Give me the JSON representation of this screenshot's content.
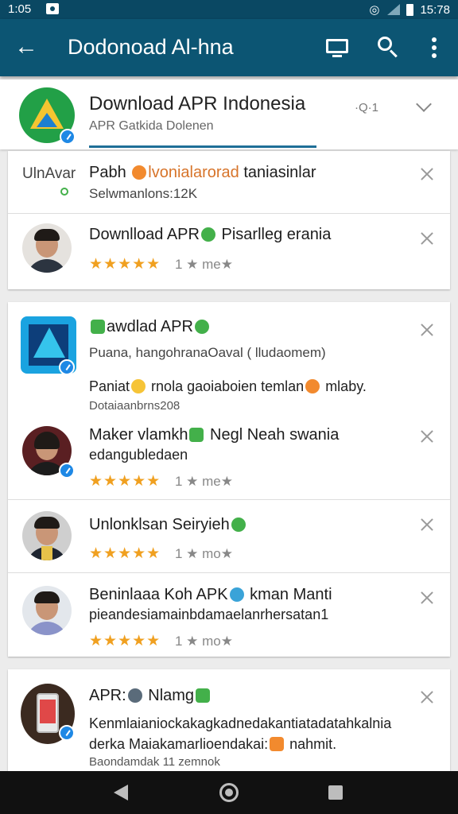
{
  "status_bar": {
    "time": "1:05",
    "clock_right": "15:78"
  },
  "app_bar": {
    "title": "Dodonoad Al-hna"
  },
  "header": {
    "title": "Download APR Indonesia",
    "subtitle": "APR Gatkida Dolenen",
    "count": "·Q·1"
  },
  "cards": {
    "c1": {
      "rows": [
        {
          "left_label": "UlnAvar",
          "title_pre": "Pabh ",
          "title_hl": "lvonialarorad",
          "title_post": " taniasinlar",
          "sub": "Selwmanlons:12K"
        },
        {
          "title": "Downlload APR",
          "title_post": " Pisarlleg erania",
          "stars": "★★★★★",
          "meta": "1 ★ me★"
        }
      ]
    },
    "c2": {
      "app_title": "awdlad APR",
      "app_sub": "Puana, hangohranaOaval ( lludaomem)",
      "desc": "Paniat",
      "desc_mid": " rnola gaoiaboien temlan",
      "desc_end": " mlaby. ",
      "desc2": "Dotaiaanbrns208",
      "rows": [
        {
          "title": "Maker vlamkh",
          "title_post": " Negl Neah swania",
          "sub": "edangubledaen",
          "stars": "★★★★★",
          "meta": "1 ★ me★"
        },
        {
          "title": "Unlonklsan Seiryieh",
          "stars": "★★★★★",
          "meta": "1 ★ mo★"
        },
        {
          "title": "Beninlaaa Koh APK",
          "title_post": " kman Manti",
          "sub": "pieandesiamainbdamaelanrhersatan1",
          "stars": "★★★★★",
          "meta": "1 ★ mo★"
        }
      ]
    },
    "c3": {
      "title": "APR:",
      "title_post": " Nlamg",
      "desc": "Kenmlaianiockakagkadnedakantiatadatahkalnia",
      "desc2": "derka Maiakamarlioendakai:",
      "desc2_post": " nahmit.",
      "desc3": "Baondamdak 11 zemnok"
    }
  },
  "colors": {
    "app_bar": "#0c5573",
    "status_bar": "#0a4863",
    "accent": "#1f6f97",
    "star": "#f0a020"
  }
}
